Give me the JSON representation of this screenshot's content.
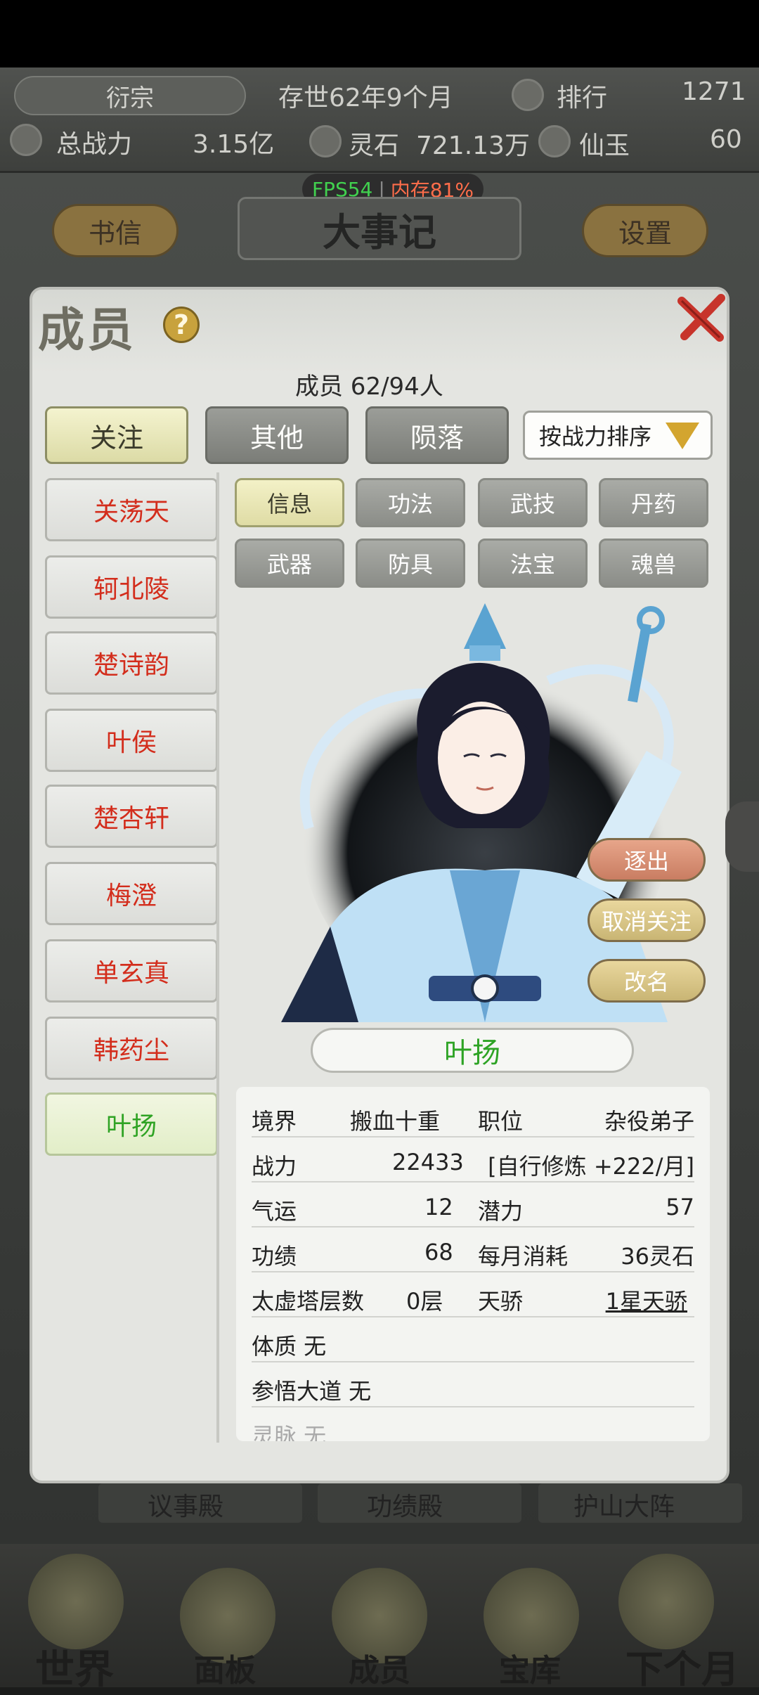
{
  "header": {
    "sect_name": "衍宗",
    "time_label": "存世62年9个月",
    "rank_label": "排行",
    "rank_value": "1271",
    "power_label": "总战力",
    "power_value": "3.15亿",
    "stone_label": "灵石",
    "stone_value": "721.13万",
    "jade_label": "仙玉",
    "jade_value": "60"
  },
  "overlay": {
    "fps": "FPS54",
    "separator": "|",
    "memory": "内存81%"
  },
  "top_buttons": {
    "letters": "书信",
    "title": "大事记",
    "settings": "设置"
  },
  "panel": {
    "title": "成员",
    "help": "?",
    "count": "成员  62/94人",
    "tabs": [
      "关注",
      "其他",
      "陨落"
    ],
    "sort_label": "按战力排序",
    "members": [
      "关荡天",
      "轲北陵",
      "楚诗韵",
      "叶侯",
      "楚杏轩",
      "梅澄",
      "单玄真",
      "韩药尘",
      "叶扬"
    ],
    "subtabs_row1": [
      "信息",
      "功法",
      "武技",
      "丹药"
    ],
    "subtabs_row2": [
      "武器",
      "防具",
      "法宝",
      "魂兽"
    ],
    "actions": {
      "expel": "逐出",
      "unfollow": "取消关注",
      "rename": "改名"
    },
    "selected_name": "叶扬"
  },
  "stats": {
    "realm_label": "境界",
    "realm_value": "搬血十重",
    "position_label": "职位",
    "position_value": "杂役弟子",
    "power_label": "战力",
    "power_value": "22433",
    "status_value": "[自行修炼 +222/月]",
    "luck_label": "气运",
    "luck_value": "12",
    "potential_label": "潜力",
    "potential_value": "57",
    "merit_label": "功绩",
    "merit_value": "68",
    "monthly_label": "每月消耗",
    "monthly_value": "36灵石",
    "tower_label": "太虚塔层数",
    "tower_value": "0层",
    "talent_label": "天骄",
    "talent_value": "1星天骄",
    "body_label": "体质 无",
    "dao_label": "参悟大道 无",
    "partial_label": "灵脉 无"
  },
  "behind": {
    "hall1": "议事殿",
    "hall2": "功绩殿",
    "hall3": "护山大阵"
  },
  "bottom_nav": [
    "世界",
    "面板",
    "成员",
    "宝库",
    "下个月"
  ]
}
